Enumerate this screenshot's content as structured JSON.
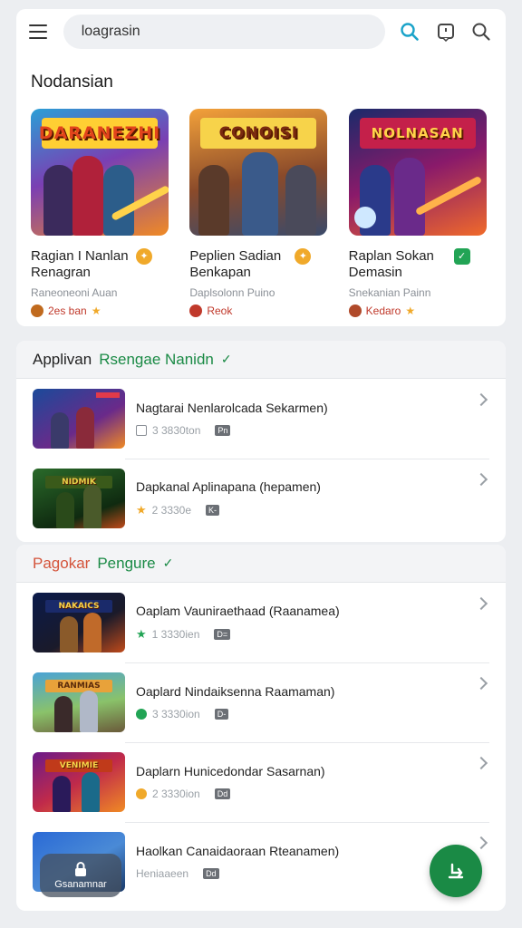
{
  "header": {
    "search_value": "loagrasin"
  },
  "featured": {
    "title": "Nodansian",
    "cards": [
      {
        "banner": "DARANEZHI",
        "name": "Ragian I Nanlan Renagran",
        "subtitle": "Raneoneoni Auan",
        "meta": "2es ban",
        "badge_color": "#f0a92a"
      },
      {
        "banner": "CONOISI",
        "name": "Peplien Sadian Benkapan",
        "subtitle": "Daplsolonn Puino",
        "meta": "Reok",
        "badge_color": "#f0a92a"
      },
      {
        "banner": "NOLNASAN",
        "name": "Raplan Sokan Demasin",
        "subtitle": "Snekanian Painn",
        "meta": "Kedaro",
        "badge_color": "#22a455"
      }
    ]
  },
  "section1": {
    "title_a": "Applivan",
    "title_b": "Rsengae Nanidn",
    "rows": [
      {
        "title": "Nagtarai Nenlarolcada Sekarmen)",
        "meta": "3 3830ton",
        "chip": "Pn",
        "icon_color": "#8a8f96"
      },
      {
        "title": "Dapkanal Aplinapana (hepamen)",
        "meta": "2 3330e",
        "chip": "K-",
        "icon_color": "#f0a92a"
      }
    ]
  },
  "section2": {
    "title_a": "Pagokar",
    "title_b": "Pengure",
    "rows": [
      {
        "title": "Oaplam Vauniraethaad (Raanamea)",
        "meta": "1 3330ien",
        "chip": "D=",
        "icon_color": "#22a455"
      },
      {
        "title": "Oaplard Nindaiksenna Raamaman)",
        "meta": "3 3330ion",
        "chip": "D-",
        "icon_color": "#22a455"
      },
      {
        "title": "Daplarn Hunicedondar Sasarnan)",
        "meta": "2 3330ion",
        "chip": "Dd",
        "icon_color": "#f0a92a"
      },
      {
        "title": "Haolkan Canaidaoraan Rteanamen)",
        "meta": "Heniaaeen",
        "chip": "Dd",
        "icon_color": "#8a8f96"
      }
    ]
  },
  "overlay": {
    "open_label": "Gsanamnar"
  },
  "colors": {
    "accent": "#1aa3c9",
    "green": "#1a8a45",
    "section_title_orange": "#d4533a"
  }
}
